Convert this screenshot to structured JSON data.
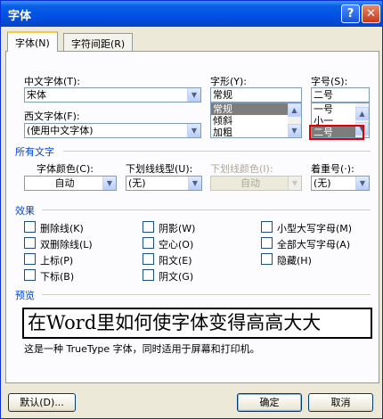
{
  "window": {
    "title": "字体",
    "help_glyph": "?",
    "close_glyph": "✕"
  },
  "tabs": [
    {
      "label": "字体(N)",
      "active": true
    },
    {
      "label": "字符间距(R)",
      "active": false
    }
  ],
  "font": {
    "chinese_label": "中文字体(T):",
    "chinese_value": "宋体",
    "western_label": "西文字体(F):",
    "western_value": "(使用中文字体)",
    "style_label": "字形(Y):",
    "style_value": "常规",
    "style_options": [
      "常规",
      "倾斜",
      "加粗"
    ],
    "size_label": "字号(S):",
    "size_value": "二号",
    "size_options": [
      "一号",
      "小一",
      "二号"
    ]
  },
  "all_text": {
    "section_label": "所有文字",
    "color_label": "字体颜色(C):",
    "color_value": "自动",
    "underline_label": "下划线线型(U):",
    "underline_value": "(无)",
    "underline_color_label": "下划线颜色(I):",
    "underline_color_value": "自动",
    "emphasis_label": "着重号(·):",
    "emphasis_value": "(无)"
  },
  "effects": {
    "section_label": "效果",
    "items": [
      {
        "label": "删除线(K)",
        "checked": false
      },
      {
        "label": "双删除线(L)",
        "checked": false
      },
      {
        "label": "上标(P)",
        "checked": false
      },
      {
        "label": "下标(B)",
        "checked": false
      },
      {
        "label": "阴影(W)",
        "checked": false
      },
      {
        "label": "空心(O)",
        "checked": false
      },
      {
        "label": "阳文(E)",
        "checked": false
      },
      {
        "label": "阴文(G)",
        "checked": false
      },
      {
        "label": "小型大写字母(M)",
        "checked": false
      },
      {
        "label": "全部大写字母(A)",
        "checked": false
      },
      {
        "label": "隐藏(H)",
        "checked": false
      }
    ]
  },
  "preview": {
    "section_label": "预览",
    "sample_text": "在Word里如何使字体变得高高大大",
    "note": "这是一种 TrueType 字体，同时适用于屏幕和打印机。"
  },
  "buttons": {
    "default": "默认(D)...",
    "ok": "确定",
    "cancel": "取消"
  },
  "colors": {
    "title_bar": "#0054e3",
    "section_text": "#0046d5",
    "dialog_bg": "#ece9d8",
    "highlight_mark": "#e00000"
  }
}
